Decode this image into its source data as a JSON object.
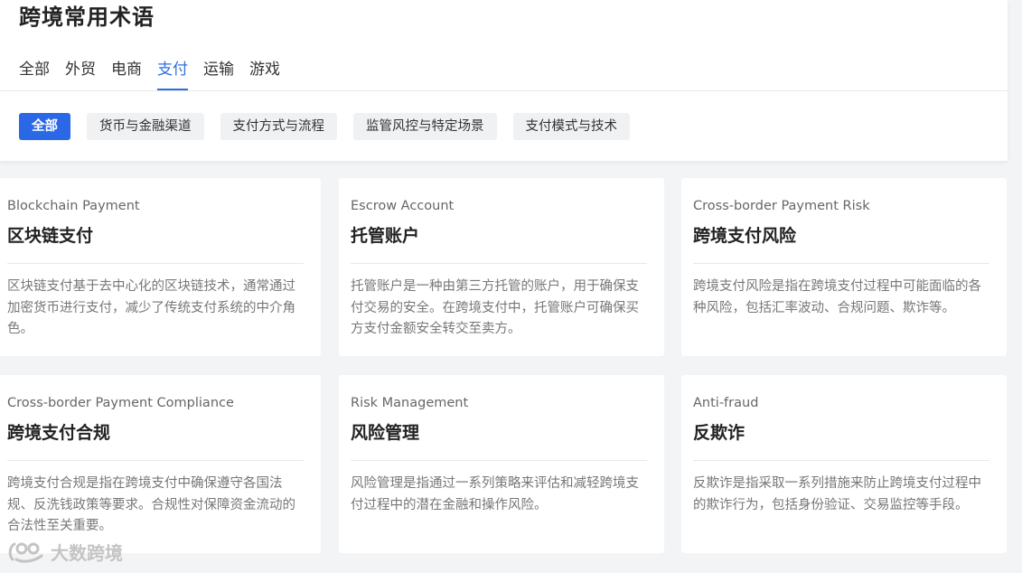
{
  "header": {
    "title": "跨境常用术语",
    "tabs": [
      "全部",
      "外贸",
      "电商",
      "支付",
      "运输",
      "游戏"
    ],
    "active_tab": "支付"
  },
  "filters": {
    "chips": [
      "全部",
      "货币与金融渠道",
      "支付方式与流程",
      "监管风控与特定场景",
      "支付模式与技术"
    ],
    "active_chip": "全部"
  },
  "cards": [
    {
      "en": "Blockchain Payment",
      "zh": "区块链支付",
      "desc": "区块链支付基于去中心化的区块链技术，通常通过加密货币进行支付，减少了传统支付系统的中介角色。"
    },
    {
      "en": "Escrow Account",
      "zh": "托管账户",
      "desc": "托管账户是一种由第三方托管的账户，用于确保支付交易的安全。在跨境支付中，托管账户可确保买方支付金额安全转交至卖方。"
    },
    {
      "en": "Cross-border Payment Risk",
      "zh": "跨境支付风险",
      "desc": "跨境支付风险是指在跨境支付过程中可能面临的各种风险，包括汇率波动、合规问题、欺诈等。"
    },
    {
      "en": "Cross-border Payment Compliance",
      "zh": "跨境支付合规",
      "desc": "跨境支付合规是指在跨境支付中确保遵守各国法规、反洗钱政策等要求。合规性对保障资金流动的合法性至关重要。"
    },
    {
      "en": "Risk Management",
      "zh": "风险管理",
      "desc": "风险管理是指通过一系列策略来评估和减轻跨境支付过程中的潜在金融和操作风险。"
    },
    {
      "en": "Anti-fraud",
      "zh": "反欺诈",
      "desc": "反欺诈是指采取一系列措施来防止跨境支付过程中的欺诈行为，包括身份验证、交易监控等手段。"
    }
  ],
  "watermark": {
    "text": "大数跨境",
    "icon": "brand-logo-icon"
  },
  "colors": {
    "accent": "#2b68e6",
    "tab_active": "#2f6fe0",
    "background": "#f3f4f6"
  }
}
